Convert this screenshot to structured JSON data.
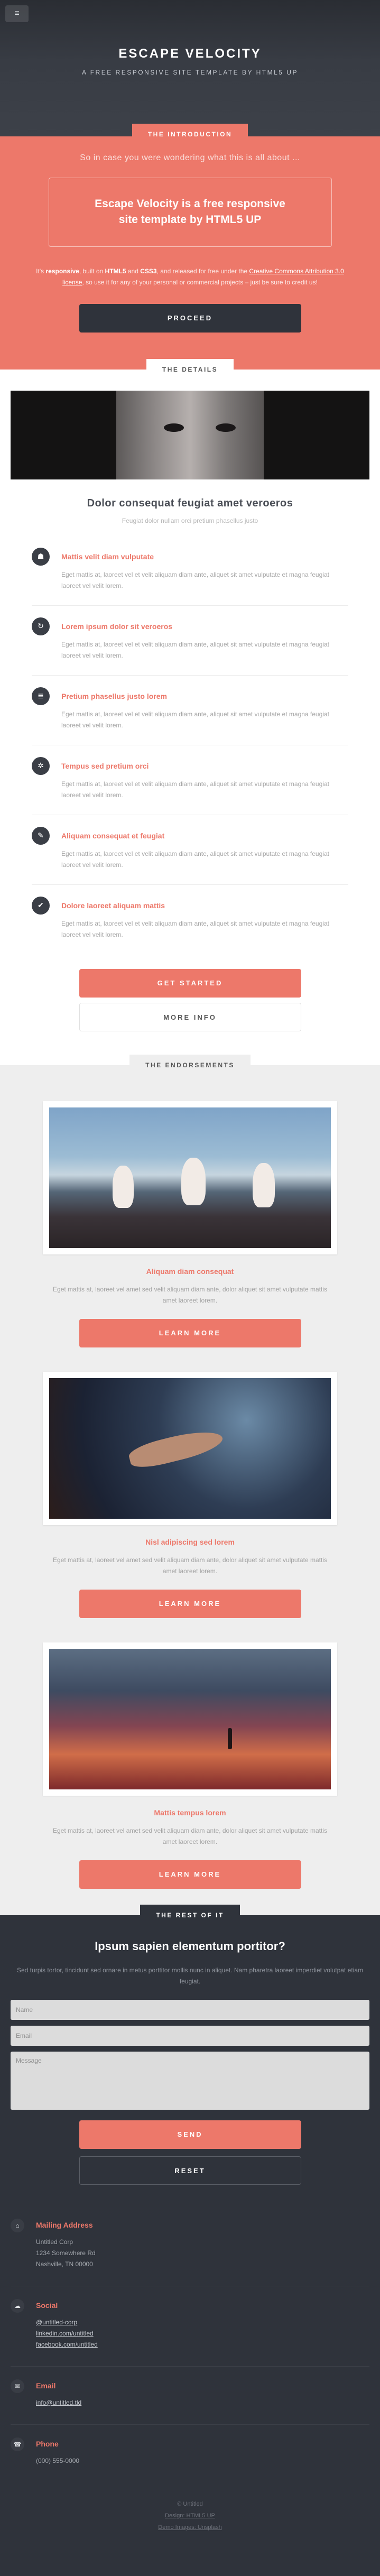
{
  "header": {
    "menu_icon": "≡",
    "title": "Escape Velocity",
    "tagline": "A free responsive site template by HTML5 UP"
  },
  "intro": {
    "tag": "The Introduction",
    "lead": "So in case you were wondering what this is all about ...",
    "box_title": "Escape Velocity is a free responsive site template by HTML5 UP",
    "text_pre": "It's ",
    "text_b1": "responsive",
    "text_mid1": ", built on ",
    "text_b2": "HTML5",
    "text_mid2": " and ",
    "text_b3": "CSS3",
    "text_mid3": ", and released for free under the ",
    "text_link": "Creative Commons Attribution 3.0 license",
    "text_post": ", so use it for any of your personal or commercial projects – just be sure to credit us!",
    "button": "Proceed"
  },
  "details": {
    "tag": "The Details",
    "title": "Dolor consequat feugiat amet veroeros",
    "subtitle": "Feugiat dolor nullam orci pretium phasellus justo",
    "features": [
      {
        "icon": "☗",
        "title": "Mattis velit diam vulputate",
        "text": "Eget mattis at, laoreet vel et velit aliquam diam ante, aliquet sit amet vulputate et magna feugiat laoreet vel velit lorem."
      },
      {
        "icon": "↻",
        "title": "Lorem ipsum dolor sit veroeros",
        "text": "Eget mattis at, laoreet vel et velit aliquam diam ante, aliquet sit amet vulputate et magna feugiat laoreet vel velit lorem."
      },
      {
        "icon": "≣",
        "title": "Pretium phasellus justo lorem",
        "text": "Eget mattis at, laoreet vel et velit aliquam diam ante, aliquet sit amet vulputate et magna feugiat laoreet vel velit lorem."
      },
      {
        "icon": "✲",
        "title": "Tempus sed pretium orci",
        "text": "Eget mattis at, laoreet vel et velit aliquam diam ante, aliquet sit amet vulputate et magna feugiat laoreet vel velit lorem."
      },
      {
        "icon": "✎",
        "title": "Aliquam consequat et feugiat",
        "text": "Eget mattis at, laoreet vel et velit aliquam diam ante, aliquet sit amet vulputate et magna feugiat laoreet vel velit lorem."
      },
      {
        "icon": "✔",
        "title": "Dolore laoreet aliquam mattis",
        "text": "Eget mattis at, laoreet vel et velit aliquam diam ante, aliquet sit amet vulputate et magna feugiat laoreet vel velit lorem."
      }
    ],
    "btn_primary": "Get Started",
    "btn_secondary": "More Info"
  },
  "endorsements": {
    "tag": "The Endorsements",
    "items": [
      {
        "title": "Aliquam diam consequat",
        "text": "Eget mattis at, laoreet vel amet sed velit aliquam diam ante, dolor aliquet sit amet vulputate mattis amet laoreet lorem.",
        "button": "Learn More"
      },
      {
        "title": "Nisl adipiscing sed lorem",
        "text": "Eget mattis at, laoreet vel amet sed velit aliquam diam ante, dolor aliquet sit amet vulputate mattis amet laoreet lorem.",
        "button": "Learn More"
      },
      {
        "title": "Mattis tempus lorem",
        "text": "Eget mattis at, laoreet vel amet sed velit aliquam diam ante, dolor aliquet sit amet vulputate mattis amet laoreet lorem.",
        "button": "Learn More"
      }
    ]
  },
  "rest": {
    "tag": "The Rest Of It",
    "title": "Ipsum sapien elementum portitor?",
    "text": "Sed turpis tortor, tincidunt sed ornare in metus porttitor mollis nunc in aliquet. Nam pharetra laoreet imperdiet volutpat etiam feugiat.",
    "form": {
      "name_placeholder": "Name",
      "email_placeholder": "Email",
      "message_placeholder": "Message",
      "send": "Send",
      "reset": "Reset"
    },
    "contacts": [
      {
        "icon": "⌂",
        "title": "Mailing Address",
        "lines": [
          "Untitled Corp",
          "1234 Somewhere Rd",
          "Nashville, TN 00000"
        ]
      },
      {
        "icon": "☁",
        "title": "Social",
        "lines": [
          "@untitled-corp",
          "linkedin.com/untitled",
          "facebook.com/untitled"
        ]
      },
      {
        "icon": "✉",
        "title": "Email",
        "lines": [
          "info@untitled.tld"
        ]
      },
      {
        "icon": "☎",
        "title": "Phone",
        "lines": [
          "(000) 555-0000"
        ]
      }
    ],
    "copyright": [
      "© Untitled",
      "Design: HTML5 UP",
      "Demo Images: Unsplash"
    ]
  },
  "colors": {
    "accent": "#ed786a",
    "dark": "#2f333b",
    "light_bg": "#eeeeee"
  }
}
